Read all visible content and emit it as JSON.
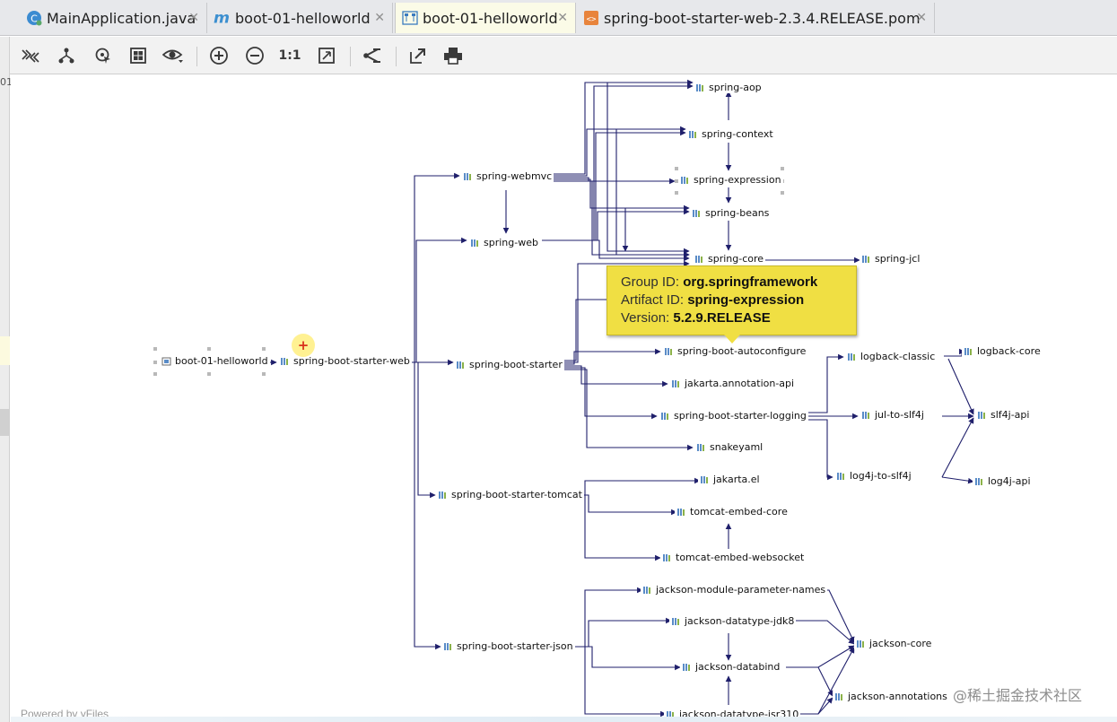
{
  "tabs": [
    {
      "label": "MainApplication.java",
      "icon": "java-class-icon",
      "active": false
    },
    {
      "label": "boot-01-helloworld",
      "icon": "maven-icon",
      "active": false
    },
    {
      "label": "boot-01-helloworld",
      "icon": "diagram-icon",
      "active": true
    },
    {
      "label": "spring-boot-starter-web-2.3.4.RELEASE.pom",
      "icon": "xml-file-icon",
      "active": false
    }
  ],
  "toolbar": {
    "actual_size_label": "1:1"
  },
  "gutter_text": "01",
  "nodes": {
    "root": "boot-01-helloworld",
    "starter_web": "spring-boot-starter-web",
    "webmvc": "spring-webmvc",
    "web": "spring-web",
    "starter": "spring-boot-starter",
    "starter_tomcat": "spring-boot-starter-tomcat",
    "starter_json": "spring-boot-starter-json",
    "aop": "spring-aop",
    "context": "spring-context",
    "expression": "spring-expression",
    "beans": "spring-beans",
    "core": "spring-core",
    "jcl": "spring-jcl",
    "autoconfigure": "spring-boot-autoconfigure",
    "annotation_api": "jakarta.annotation-api",
    "starter_logging": "spring-boot-starter-logging",
    "snakeyaml": "snakeyaml",
    "logback_classic": "logback-classic",
    "logback_core": "logback-core",
    "jul_to_slf4j": "jul-to-slf4j",
    "slf4j_api": "slf4j-api",
    "log4j_to_slf4j": "log4j-to-slf4j",
    "log4j_api": "log4j-api",
    "jakarta_el": "jakarta.el",
    "tomcat_embed_core": "tomcat-embed-core",
    "tomcat_embed_websocket": "tomcat-embed-websocket",
    "jackson_param_names": "jackson-module-parameter-names",
    "jackson_jdk8": "jackson-datatype-jdk8",
    "jackson_databind": "jackson-databind",
    "jackson_jsr310": "jackson-datatype-jsr310",
    "jackson_core": "jackson-core",
    "jackson_annotations": "jackson-annotations"
  },
  "tooltip": {
    "group_label": "Group ID:",
    "group_value": "org.springframework",
    "artifact_label": "Artifact ID:",
    "artifact_value": "spring-expression",
    "version_label": "Version:",
    "version_value": "5.2.9.RELEASE"
  },
  "powered_by": "Powered by yFiles",
  "watermark": "@稀土掘金技术社区",
  "colors": {
    "edge": "#1f1f6b",
    "tooltip_bg": "#f0df43",
    "active_tab_bg": "#fbfbe7",
    "toolbar_bg": "#f2f2f2"
  }
}
